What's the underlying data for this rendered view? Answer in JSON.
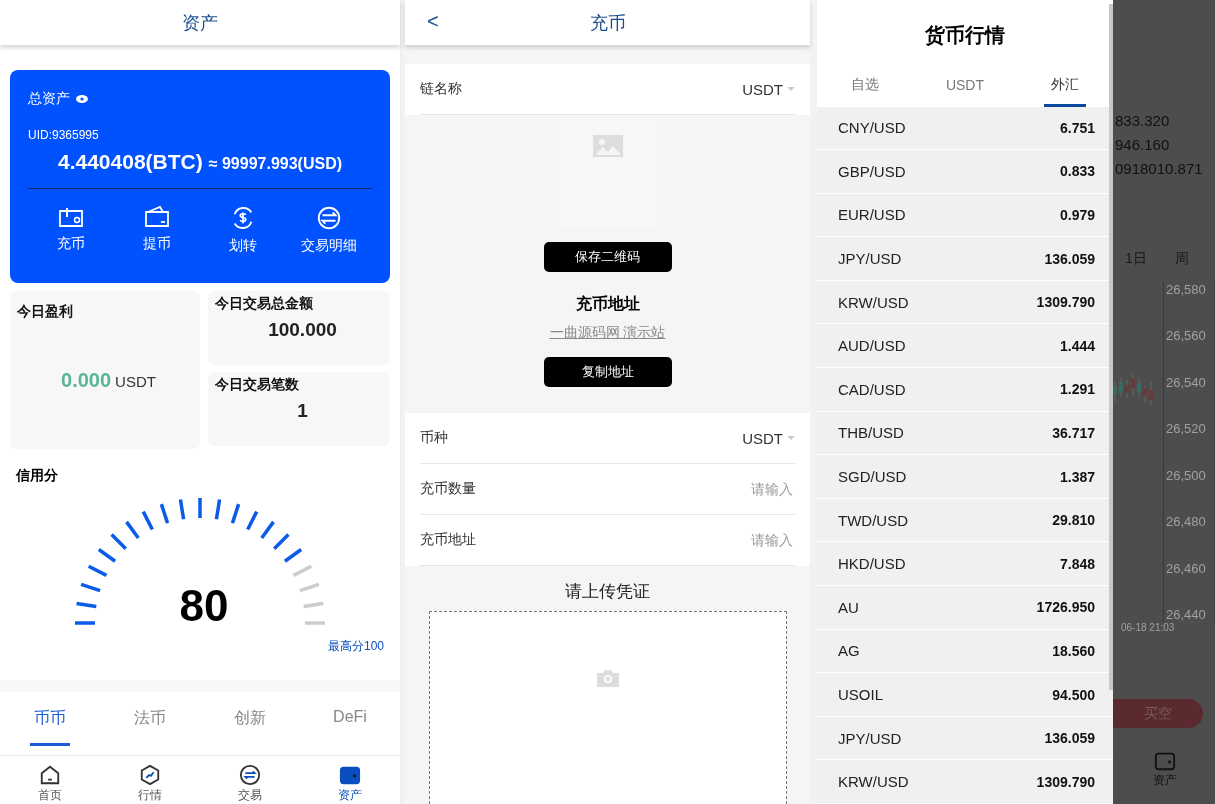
{
  "assets": {
    "header": {
      "title": "资产"
    },
    "card": {
      "label": "总资产",
      "uid": "UID:9365995",
      "btc": "4.440408(BTC)",
      "approx": "≈ 99997.993(USD)",
      "actions": [
        {
          "kind": "deposit",
          "label": "充币"
        },
        {
          "kind": "withdraw",
          "label": "提币"
        },
        {
          "kind": "transfer",
          "label": "划转"
        },
        {
          "kind": "detail",
          "label": "交易明细"
        }
      ]
    },
    "profit": {
      "label": "今日盈利",
      "value": "0.000",
      "unit": "USDT"
    },
    "volume": {
      "label": "今日交易总金额",
      "value": "100.000"
    },
    "count": {
      "label": "今日交易笔数",
      "value": "1"
    },
    "credit": {
      "title": "信用分",
      "score": "80",
      "level": 0.8,
      "max": "最高分100"
    },
    "tabs": [
      {
        "label": "币币",
        "selected": true
      },
      {
        "label": "法币",
        "selected": false
      },
      {
        "label": "创新",
        "selected": false
      },
      {
        "label": "DeFi",
        "selected": false
      }
    ],
    "nav": [
      {
        "kind": "home",
        "label": "首页",
        "selected": false
      },
      {
        "kind": "market",
        "label": "行情",
        "selected": false
      },
      {
        "kind": "trade",
        "label": "交易",
        "selected": false
      },
      {
        "kind": "wallet",
        "label": "资产",
        "selected": true
      }
    ]
  },
  "deposit": {
    "header": {
      "back": "<",
      "title": "充币"
    },
    "chain": {
      "label": "链名称",
      "value": "USDT"
    },
    "qr": {
      "save": "保存二维码",
      "address_title": "充币地址",
      "address": "一曲源码网 演示站",
      "copy": "复制地址"
    },
    "fields": [
      {
        "kind": "select",
        "label": "币种",
        "value": "USDT"
      },
      {
        "kind": "input",
        "label": "充币数量",
        "placeholder": "请输入"
      },
      {
        "kind": "input",
        "label": "充币地址",
        "placeholder": "请输入"
      }
    ],
    "upload": {
      "title": "请上传凭证"
    }
  },
  "market": {
    "title": "货币行情",
    "tabs": [
      {
        "label": "自选",
        "selected": false
      },
      {
        "label": "USDT",
        "selected": false
      },
      {
        "label": "外汇",
        "selected": true
      }
    ],
    "rows": [
      {
        "pair": "CNY/USD",
        "price": "6.751"
      },
      {
        "pair": "GBP/USD",
        "price": "0.833"
      },
      {
        "pair": "EUR/USD",
        "price": "0.979"
      },
      {
        "pair": "JPY/USD",
        "price": "136.059"
      },
      {
        "pair": "KRW/USD",
        "price": "1309.790"
      },
      {
        "pair": "AUD/USD",
        "price": "1.444"
      },
      {
        "pair": "CAD/USD",
        "price": "1.291"
      },
      {
        "pair": "THB/USD",
        "price": "36.717"
      },
      {
        "pair": "SGD/USD",
        "price": "1.387"
      },
      {
        "pair": "TWD/USD",
        "price": "29.810"
      },
      {
        "pair": "HKD/USD",
        "price": "7.848"
      },
      {
        "pair": "AU",
        "price": "1726.950"
      },
      {
        "pair": "AG",
        "price": "18.560"
      },
      {
        "pair": "USOIL",
        "price": "94.500"
      },
      {
        "pair": "JPY/USD",
        "price": "136.059"
      },
      {
        "pair": "KRW/USD",
        "price": "1309.790"
      }
    ]
  },
  "background": {
    "figures": [
      "833.320",
      "946.160",
      "0918010.871"
    ],
    "periods": [
      "1日",
      "周"
    ],
    "axis_labels": [
      "26,580",
      "26,560",
      "26,540",
      "26,520",
      "26,500",
      "26,480",
      "26,460",
      "26,440"
    ],
    "time_label": "06-18 21:03",
    "sell_button": "买空",
    "nav_label": "资产"
  }
}
